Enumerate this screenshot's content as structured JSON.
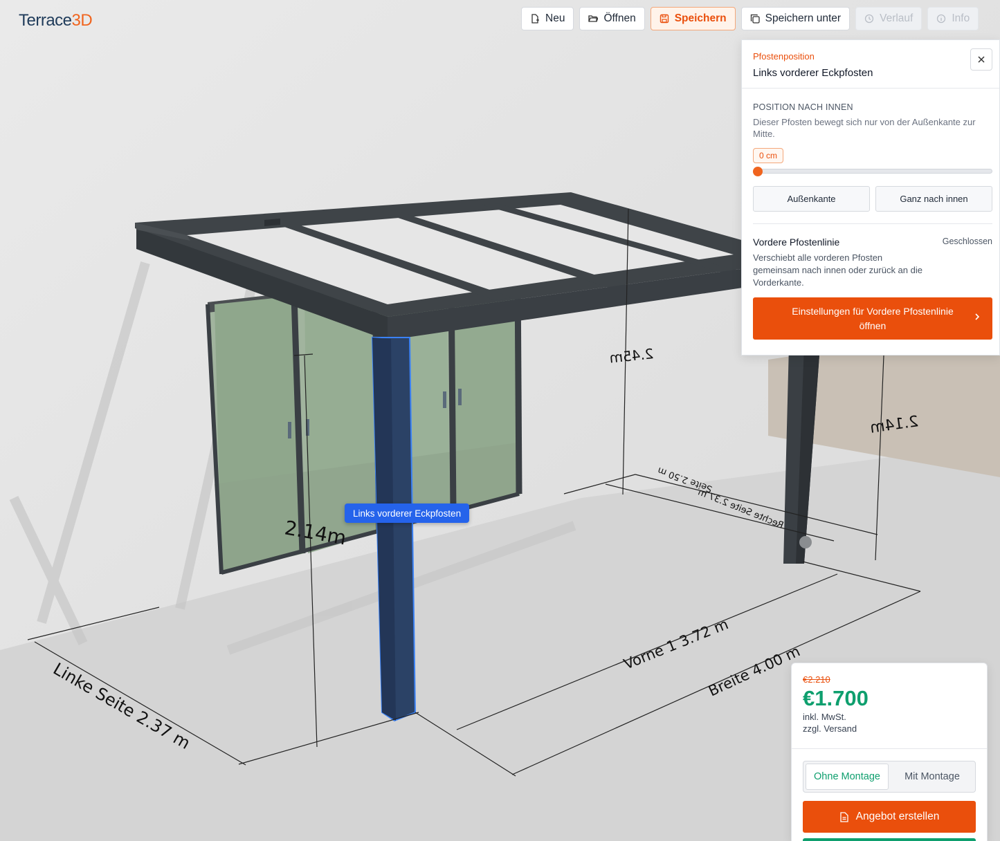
{
  "app": {
    "logo_main": "Terrace",
    "logo_accent": "3D"
  },
  "toolbar": {
    "new_label": "Neu",
    "open_label": "Öffnen",
    "save_label": "Speichern",
    "save_as_label": "Speichern unter",
    "history_label": "Verlauf",
    "info_label": "Info"
  },
  "panel": {
    "kicker": "Pfostenposition",
    "title": "Links vorderer Eckpfosten",
    "inward": {
      "label": "POSITION NACH INNEN",
      "description": "Dieser Pfosten bewegt sich nur von der Außenkante zur Mitte.",
      "value_display": "0 cm",
      "slider_value": 0,
      "outer_edge_label": "Außenkante",
      "fully_inside_label": "Ganz nach innen"
    },
    "front_line": {
      "title": "Vordere Pfostenlinie",
      "status": "Geschlossen",
      "description": "Verschiebt alle vorderen Pfosten gemeinsam nach innen oder zurück an die Vorderkante.",
      "button_label": "Einstellungen für Vordere Pfostenlinie öffnen"
    }
  },
  "scene": {
    "post_tag": "Links vorderer Eckpfosten",
    "dims": {
      "left_side": "Linke Seite 2.37 m",
      "front": "Vorne 1  3.72 m",
      "width": "Breite 4.00 m",
      "height_front": "2.14m",
      "height_back": "2.45m",
      "height_right": "2.14m",
      "right_side": "Rechte Seite  2.37 m",
      "right_side_2": "Seite  2.50 m"
    }
  },
  "price": {
    "old": "€2.210",
    "current": "€1.700",
    "note_vat": "inkl. MwSt.",
    "note_shipping": "zzgl. Versand",
    "option_without": "Ohne Montage",
    "option_with": "Mit Montage",
    "offer_label": "Angebot erstellen"
  },
  "colors": {
    "accent": "#ea4f0c",
    "price_green": "#0e9f6e",
    "selection_blue": "#2563eb",
    "frame": "#3a3f44"
  }
}
